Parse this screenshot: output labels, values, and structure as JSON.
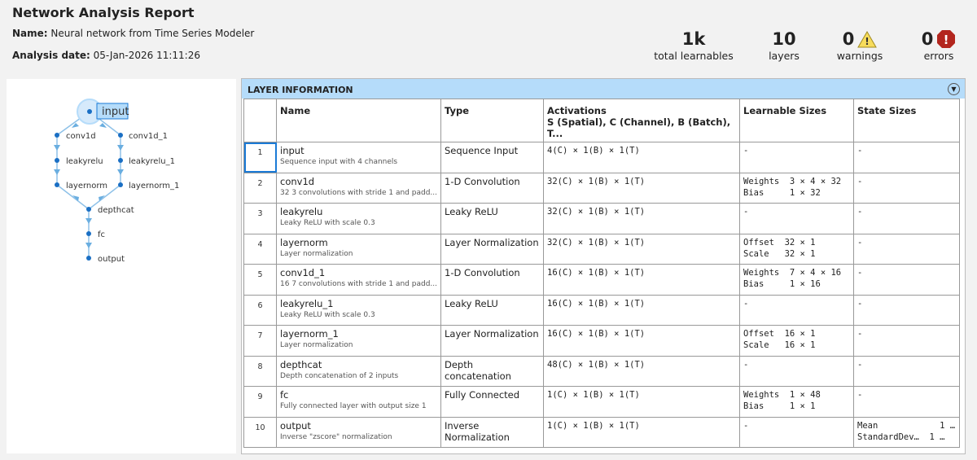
{
  "header": {
    "title": "Network Analysis Report",
    "name_label": "Name:",
    "name_value": "Neural network from Time Series Modeler",
    "date_label": "Analysis date:",
    "date_value": "05-Jan-2026 11:11:26"
  },
  "stats": [
    {
      "value": "1k",
      "label": "total learnables"
    },
    {
      "value": "10",
      "label": "layers"
    },
    {
      "value": "0",
      "label": "warnings",
      "icon": "warning-icon",
      "color": "#f5d742"
    },
    {
      "value": "0",
      "label": "errors",
      "icon": "error-icon",
      "color": "#b3261e"
    }
  ],
  "graph": {
    "nodes": [
      "input",
      "conv1d",
      "leakyrelu",
      "layernorm",
      "conv1d_1",
      "leakyrelu_1",
      "layernorm_1",
      "depthcat",
      "fc",
      "output"
    ],
    "selected": "input",
    "accent": "#1a6fc4"
  },
  "panel": {
    "title": "LAYER INFORMATION"
  },
  "table": {
    "headers": [
      "",
      "Name",
      "Type",
      "Activations",
      "Learnable Sizes",
      "State Sizes"
    ],
    "activations_sub": "S (Spatial), C (Channel), B (Batch), T...",
    "rows": [
      {
        "n": "1",
        "name": "input",
        "desc": "Sequence input with 4 channels",
        "type": "Sequence Input",
        "act": "4(C) × 1(B) × 1(T)",
        "learn": "-",
        "state": "-"
      },
      {
        "n": "2",
        "name": "conv1d",
        "desc": "32 3 convolutions with stride 1 and padd...",
        "type": "1-D Convolution",
        "act": "32(C) × 1(B) × 1(T)",
        "learn": "Weights  3 × 4 × 32\nBias     1 × 32",
        "state": "-"
      },
      {
        "n": "3",
        "name": "leakyrelu",
        "desc": "Leaky ReLU with scale 0.3",
        "type": "Leaky ReLU",
        "act": "32(C) × 1(B) × 1(T)",
        "learn": "-",
        "state": "-"
      },
      {
        "n": "4",
        "name": "layernorm",
        "desc": "Layer normalization",
        "type": "Layer Normalization",
        "act": "32(C) × 1(B) × 1(T)",
        "learn": "Offset  32 × 1\nScale   32 × 1",
        "state": "-"
      },
      {
        "n": "5",
        "name": "conv1d_1",
        "desc": "16 7 convolutions with stride 1 and padd...",
        "type": "1-D Convolution",
        "act": "16(C) × 1(B) × 1(T)",
        "learn": "Weights  7 × 4 × 16\nBias     1 × 16",
        "state": "-"
      },
      {
        "n": "6",
        "name": "leakyrelu_1",
        "desc": "Leaky ReLU with scale 0.3",
        "type": "Leaky ReLU",
        "act": "16(C) × 1(B) × 1(T)",
        "learn": "-",
        "state": "-"
      },
      {
        "n": "7",
        "name": "layernorm_1",
        "desc": "Layer normalization",
        "type": "Layer Normalization",
        "act": "16(C) × 1(B) × 1(T)",
        "learn": "Offset  16 × 1\nScale   16 × 1",
        "state": "-"
      },
      {
        "n": "8",
        "name": "depthcat",
        "desc": "Depth concatenation of 2 inputs",
        "type": "Depth concatenation",
        "act": "48(C) × 1(B) × 1(T)",
        "learn": "-",
        "state": "-"
      },
      {
        "n": "9",
        "name": "fc",
        "desc": "Fully connected layer with output size 1",
        "type": "Fully Connected",
        "act": "1(C) × 1(B) × 1(T)",
        "learn": "Weights  1 × 48\nBias     1 × 1",
        "state": "-"
      },
      {
        "n": "10",
        "name": "output",
        "desc": "Inverse \"zscore\" normalization",
        "type": "Inverse Normalization",
        "act": "1(C) × 1(B) × 1(T)",
        "learn": "-",
        "state": "Mean            1 …\nStandardDev…  1 …"
      }
    ]
  }
}
